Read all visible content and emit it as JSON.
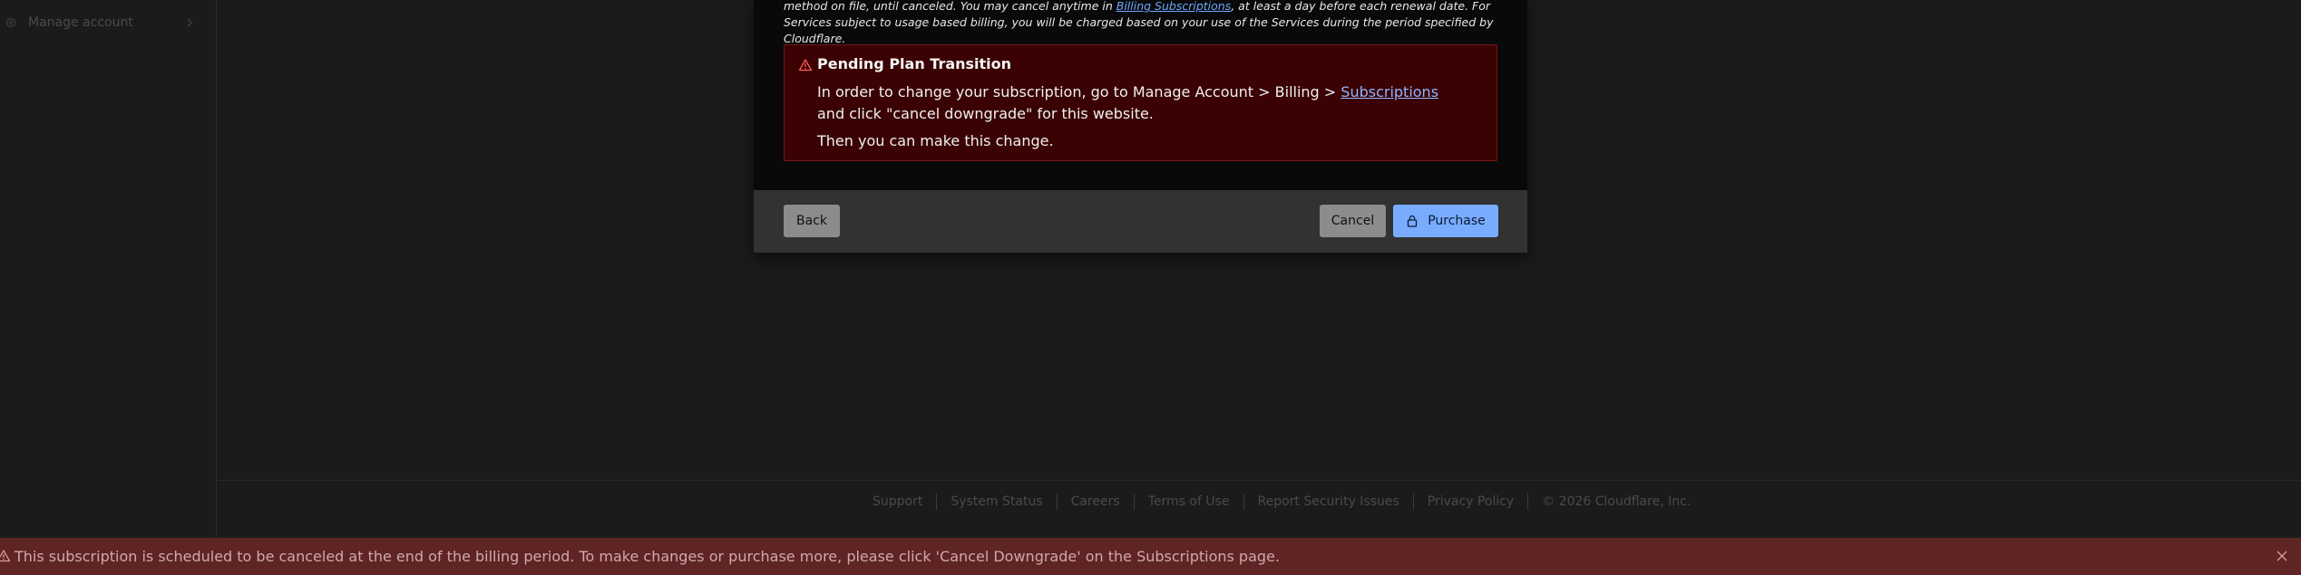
{
  "sidebar": {
    "manage_account_label": "Manage account"
  },
  "modal": {
    "terms_text_1": "method on file, until canceled. You may cancel anytime in ",
    "terms_link": "Billing Subscriptions",
    "terms_text_2": ", at least a day before each renewal date. For Services subject to usage based billing, you will be charged based on your use of the Services during the period specified by Cloudflare.",
    "alert": {
      "title": "Pending Plan Transition",
      "message_1": "In order to change your subscription, go to Manage Account > Billing > ",
      "message_link": "Subscriptions",
      "message_2": " and click \"cancel downgrade\" for this website.",
      "message_3": "Then you can make this change."
    },
    "footer": {
      "back_label": "Back",
      "cancel_label": "Cancel",
      "purchase_label": "Purchase"
    }
  },
  "page_footer": {
    "links": [
      "Support",
      "System Status",
      "Careers",
      "Terms of Use",
      "Report Security Issues",
      "Privacy Policy"
    ],
    "copyright": "© 2026 Cloudflare, Inc."
  },
  "banner": {
    "text": "This subscription is scheduled to be canceled at the end of the billing period. To make changes or purchase more, please click 'Cancel Downgrade' on the Subscriptions page."
  },
  "colors": {
    "alert_background": "#3a0202",
    "banner_background": "#5f2424",
    "purchase_button": "#79acff"
  }
}
